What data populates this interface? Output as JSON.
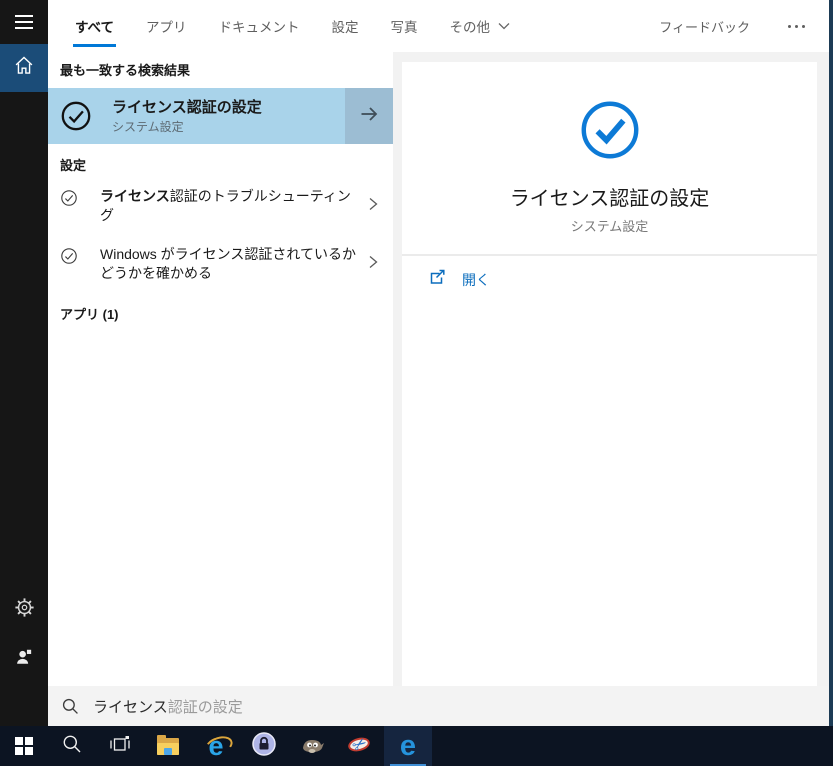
{
  "colors": {
    "accent_blue": "#0078d7",
    "best_match_highlight": "#a9d3ea",
    "arrow_box_blue": "#9cbdd3",
    "link_blue": "#0b6dbd",
    "rail_selected_blue": "#1b4c78",
    "taskbar_bg": "#0c1422"
  },
  "header": {
    "tabs": [
      {
        "label": "すべて",
        "selected": true
      },
      {
        "label": "アプリ",
        "selected": false
      },
      {
        "label": "ドキュメント",
        "selected": false
      },
      {
        "label": "設定",
        "selected": false
      },
      {
        "label": "写真",
        "selected": false
      },
      {
        "label": "その他",
        "selected": false,
        "has_dropdown": true
      }
    ],
    "feedback_label": "フィードバック",
    "more_icon": "ellipsis"
  },
  "left": {
    "best_match": {
      "section_label": "最も一致する検索結果",
      "title": "ライセンス認証の設定",
      "subtitle": "システム設定",
      "icon": "checkmark-circle-icon",
      "arrow_icon": "arrow-right-icon"
    },
    "settings": {
      "label": "設定",
      "items": [
        {
          "bold": "ライセンス",
          "rest": "認証のトラブルシューティング",
          "icon": "checkmark-circle-icon"
        },
        {
          "bold": "",
          "rest": "Windows がライセンス認証されているかどうかを確かめる",
          "icon": "checkmark-circle-icon"
        }
      ]
    },
    "apps": {
      "label": "アプリ (1)"
    }
  },
  "preview": {
    "icon": "checkmark-circle-icon",
    "title": "ライセンス認証の設定",
    "subtitle": "システム設定",
    "open_label": "開く",
    "open_icon": "open-external-icon"
  },
  "search": {
    "icon": "search-icon",
    "typed": "ライセンス",
    "suggestion": "認証の設定"
  },
  "sidebar": {
    "icons": [
      "hamburger-icon",
      "home-icon",
      "gear-icon",
      "user-icon"
    ],
    "selected": "home"
  },
  "taskbar": {
    "icons": [
      "start",
      "search",
      "task-view",
      "file-explorer",
      "internet-explorer",
      "keepass",
      "gimp",
      "snipping-app",
      "edge"
    ],
    "active_icon": "edge"
  }
}
